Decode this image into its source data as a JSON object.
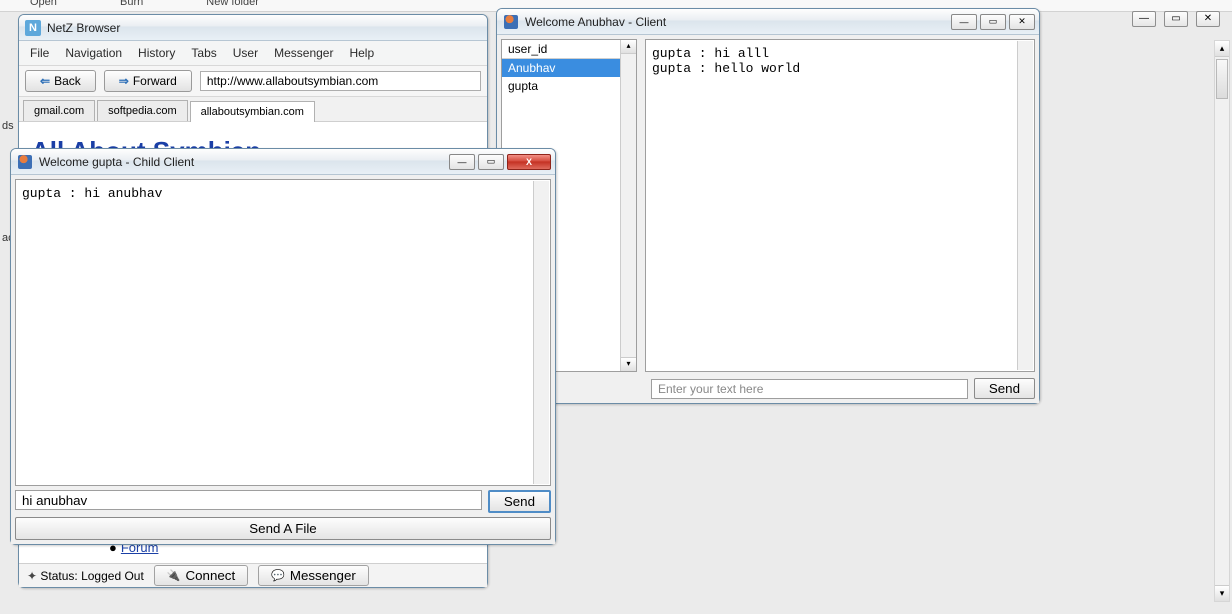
{
  "top_fragment": {
    "open": "Open",
    "burn": "Burn",
    "new_folder": "New folder"
  },
  "left_edge": {
    "l1": "ds",
    "l2": "ace"
  },
  "outer_controls": {
    "min": "—",
    "max": "▭",
    "close": "✕"
  },
  "browser": {
    "icon_text": "N",
    "title": "NetZ Browser",
    "menu": [
      "File",
      "Navigation",
      "History",
      "Tabs",
      "User",
      "Messenger",
      "Help"
    ],
    "back_label": "Back",
    "forward_label": "Forward",
    "url": "http://www.allaboutsymbian.com",
    "tabs": [
      {
        "label": "gmail.com",
        "active": false
      },
      {
        "label": "softpedia.com",
        "active": false
      },
      {
        "label": "allaboutsymbian.com",
        "active": true
      }
    ],
    "page_heading": "All About Symbian",
    "forum_link": "Forum",
    "status_text": "Status: Logged Out",
    "connect_btn": "Connect",
    "messenger_btn": "Messenger",
    "title_buttons": {
      "min": "—",
      "max": "▭",
      "close": "✕"
    }
  },
  "anubhav": {
    "title": "Welcome Anubhav - Client",
    "title_buttons": {
      "min": "—",
      "max": "▭",
      "close": "✕"
    },
    "user_list_header": "user_id",
    "users": [
      {
        "name": "Anubhav",
        "selected": true
      },
      {
        "name": "gupta",
        "selected": false
      }
    ],
    "chat_lines": [
      "gupta : hi alll",
      "gupta : hello world"
    ],
    "input_placeholder": "Enter your text here",
    "send_label": "Send"
  },
  "gupta": {
    "title": "Welcome gupta - Child Client",
    "title_buttons": {
      "min": "—",
      "max": "▭",
      "close": "X"
    },
    "chat_lines": [
      "gupta : hi anubhav"
    ],
    "input_value": "hi anubhav",
    "send_label": "Send",
    "sendfile_label": "Send A File"
  }
}
